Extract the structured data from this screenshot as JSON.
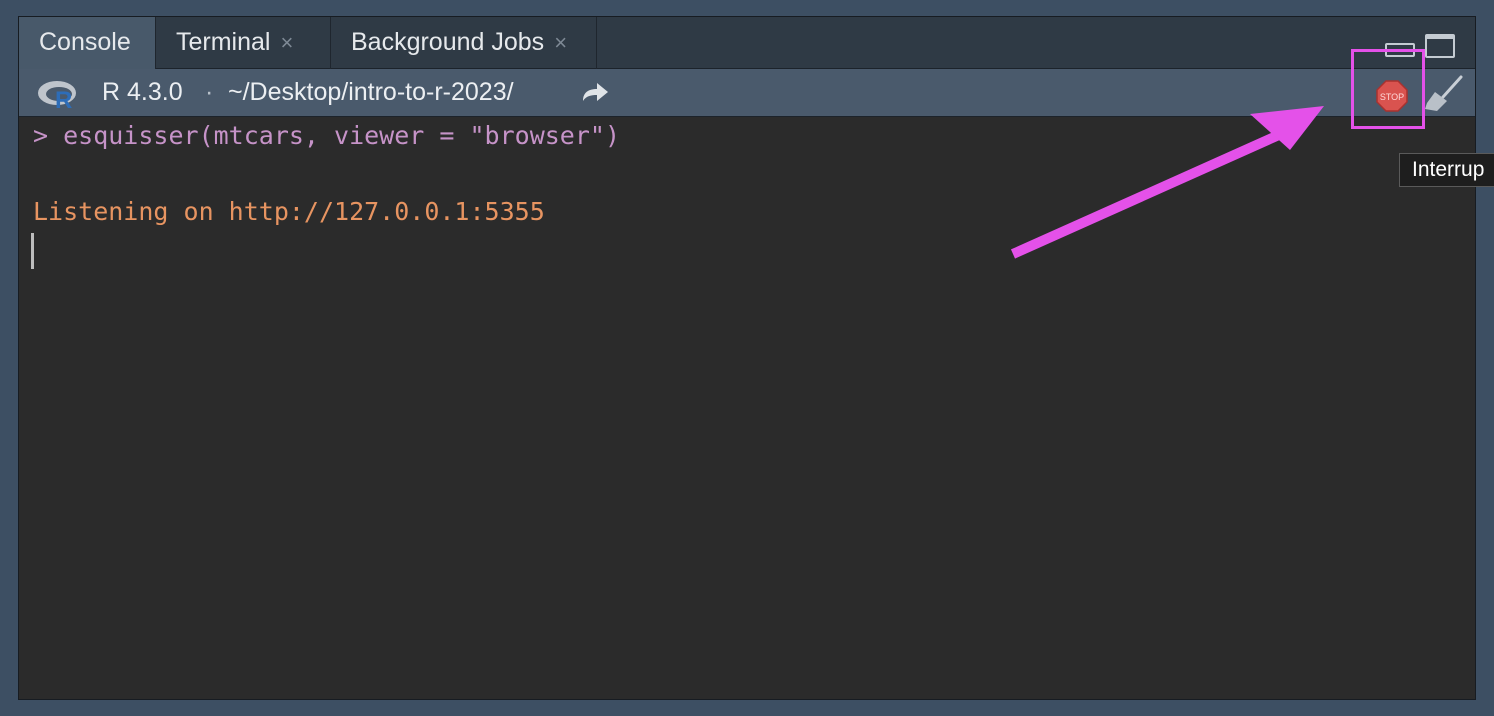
{
  "tabs": [
    {
      "label": "Console",
      "active": true,
      "closable": false
    },
    {
      "label": "Terminal",
      "active": false,
      "closable": true
    },
    {
      "label": "Background Jobs",
      "active": false,
      "closable": true
    }
  ],
  "tab_close_glyph": "×",
  "toolbar": {
    "r_version": "R 4.3.0",
    "separator": "·",
    "working_dir": "~/Desktop/intro-to-r-2023/",
    "stop_label": "STOP"
  },
  "console": {
    "lines": [
      {
        "text": "> esquisser(mtcars, viewer = \"browser\")",
        "kind": "command"
      },
      {
        "text": "Listening on http://127.0.0.1:5355",
        "kind": "output"
      }
    ]
  },
  "tooltip": {
    "text": "Interrup"
  },
  "colors": {
    "annotation": "#e451e9",
    "command_text": "#c693c8",
    "output_text": "#e79461",
    "stop_red": "#d9534f"
  },
  "icons": [
    "r-logo-icon",
    "go-to-directory-icon",
    "stop-icon",
    "clear-console-broom-icon",
    "minimize-icon",
    "maximize-icon"
  ]
}
